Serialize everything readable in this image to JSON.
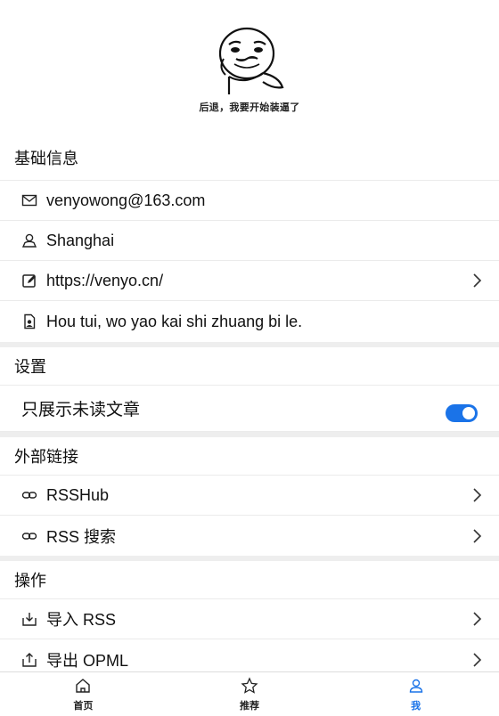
{
  "profile": {
    "avatar_caption": "后退，我要开始装逼了"
  },
  "basic_info": {
    "title": "基础信息",
    "email": "venyowong@163.com",
    "location": "Shanghai",
    "website": "https://venyo.cn/",
    "bio": "Hou tui, wo yao kai shi zhuang bi le."
  },
  "settings": {
    "title": "设置",
    "unread_only_label": "只展示未读文章",
    "unread_only_enabled": true
  },
  "external_links": {
    "title": "外部链接",
    "items": [
      {
        "label": "RSSHub"
      },
      {
        "label": "RSS 搜索"
      }
    ]
  },
  "actions": {
    "title": "操作",
    "items": [
      {
        "label": "导入 RSS"
      },
      {
        "label": "导出 OPML"
      }
    ]
  },
  "tabbar": {
    "items": [
      {
        "label": "首页",
        "icon": "home-icon"
      },
      {
        "label": "推荐",
        "icon": "star-icon"
      },
      {
        "label": "我",
        "icon": "user-icon",
        "active": true
      }
    ]
  },
  "colors": {
    "accent": "#1a73e8"
  }
}
